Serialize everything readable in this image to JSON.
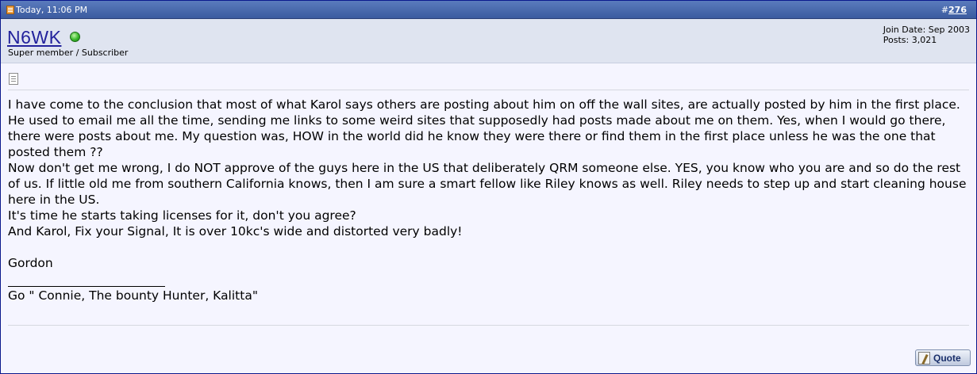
{
  "post": {
    "date": "Today, 11:06 PM",
    "number_prefix": "#",
    "number": "276"
  },
  "user": {
    "name": "N6WK",
    "title": "Super member / Subscriber",
    "join_date": "Join Date: Sep 2003",
    "posts": "Posts: 3,021"
  },
  "message": {
    "lines": [
      "I have come to the conclusion that most of what Karol says others are posting about him on off the wall sites, are actually posted by him in the first place.",
      "He used to email me all the time, sending me links to some weird sites that supposedly had posts made about me on them. Yes, when I would go there, there were posts about me. My question was, HOW in the world did he know they were there or find them in the first place unless he was the one that posted them ??",
      "Now don't get me wrong, I do NOT approve of the guys here in the US that deliberately QRM someone else. YES, you know who you are and so do the rest of us. If little old me from southern California knows, then I am sure a smart fellow like Riley knows as well. Riley needs to step up and start cleaning house here in the US.",
      "It's time he starts taking licenses for it, don't you agree?",
      "And Karol, Fix your Signal, It is over 10kc's wide and distorted very badly!"
    ],
    "sign_off": "Gordon"
  },
  "signature": {
    "text": "Go \" Connie, The bounty Hunter, Kalitta\""
  },
  "buttons": {
    "quote_label": "Quote"
  },
  "icons": {
    "post_icon": "post-icon",
    "status_icon": "online-status-icon",
    "message_icon": "message-icon",
    "quote_icon": "quote-icon"
  }
}
